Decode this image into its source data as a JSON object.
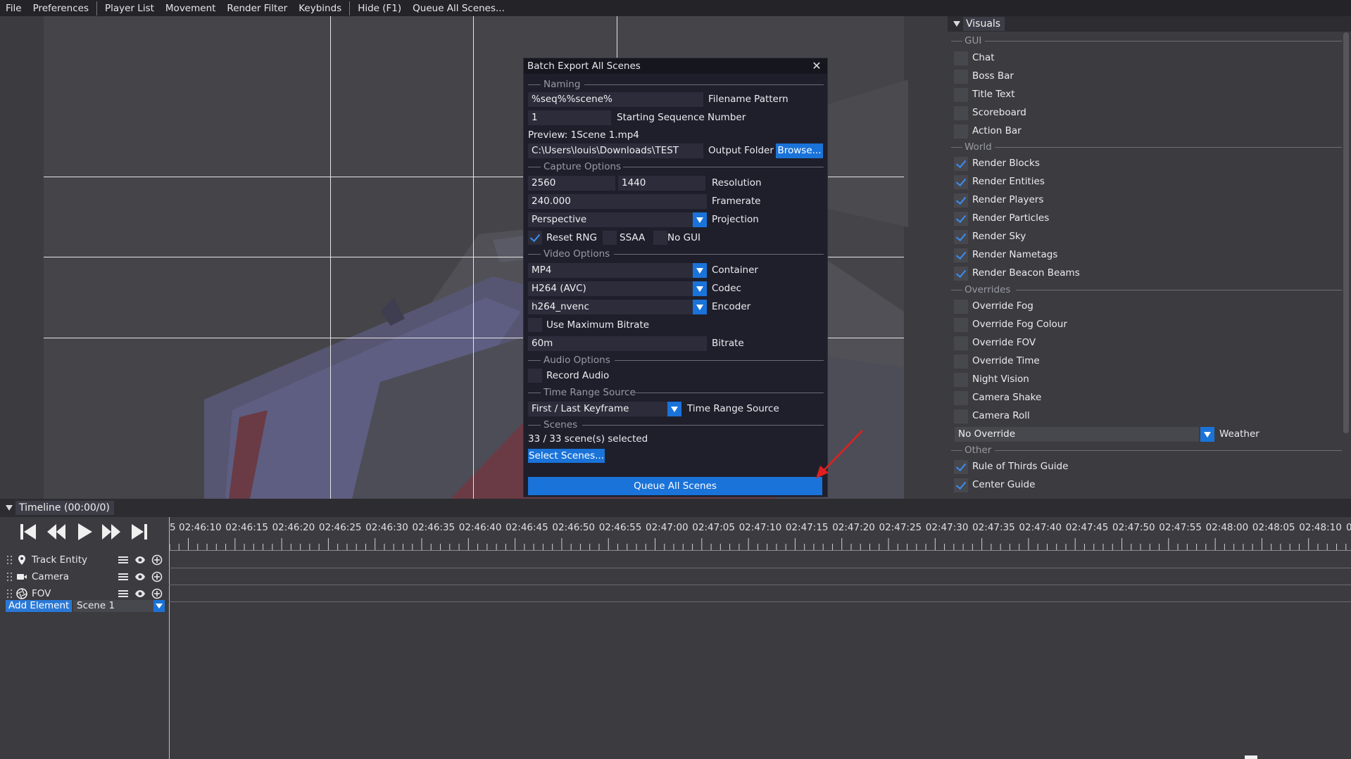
{
  "menu": {
    "items": [
      "File",
      "Preferences",
      "Player List",
      "Movement",
      "Render Filter",
      "Keybinds",
      "Hide (F1)",
      "Queue All Scenes..."
    ]
  },
  "dialog": {
    "title": "Batch Export All Scenes",
    "naming": {
      "section": "Naming",
      "filename_pattern_value": "%seq%%scene%",
      "filename_pattern_label": "Filename Pattern",
      "start_seq_value": "1",
      "start_seq_label": "Starting Sequence Number",
      "preview": "Preview: 1Scene 1.mp4",
      "output_folder_value": "C:\\Users\\louis\\Downloads\\TEST",
      "output_folder_label": "Output Folder",
      "browse_label": "Browse..."
    },
    "capture": {
      "section": "Capture Options",
      "width": "2560",
      "height": "1440",
      "resolution_label": "Resolution",
      "framerate_value": "240.000",
      "framerate_label": "Framerate",
      "projection_value": "Perspective",
      "projection_label": "Projection",
      "reset_rng_label": "Reset RNG",
      "reset_rng_checked": true,
      "ssaa_label": "SSAA",
      "ssaa_checked": false,
      "no_gui_label": "No GUI",
      "no_gui_checked": false
    },
    "video": {
      "section": "Video Options",
      "container_value": "MP4",
      "container_label": "Container",
      "codec_value": "H264 (AVC)",
      "codec_label": "Codec",
      "encoder_value": "h264_nvenc",
      "encoder_label": "Encoder",
      "max_bitrate_label": "Use Maximum Bitrate",
      "bitrate_value": "60m",
      "bitrate_label": "Bitrate"
    },
    "audio": {
      "section": "Audio Options",
      "record_audio_label": "Record Audio"
    },
    "time_range": {
      "section": "Time Range Source",
      "value": "First / Last Keyframe",
      "label": "Time Range Source"
    },
    "scenes": {
      "section": "Scenes",
      "selected_text": "33 / 33 scene(s) selected",
      "select_button": "Select Scenes..."
    },
    "queue_button": "Queue All Scenes"
  },
  "visuals": {
    "title": "Visuals",
    "gui_section": "GUI",
    "gui": [
      {
        "label": "Chat",
        "checked": false
      },
      {
        "label": "Boss Bar",
        "checked": false
      },
      {
        "label": "Title Text",
        "checked": false
      },
      {
        "label": "Scoreboard",
        "checked": false
      },
      {
        "label": "Action Bar",
        "checked": false
      }
    ],
    "world_section": "World",
    "world": [
      {
        "label": "Render Blocks",
        "checked": true
      },
      {
        "label": "Render Entities",
        "checked": true
      },
      {
        "label": "Render Players",
        "checked": true
      },
      {
        "label": "Render Particles",
        "checked": true
      },
      {
        "label": "Render Sky",
        "checked": true
      },
      {
        "label": "Render Nametags",
        "checked": true
      },
      {
        "label": "Render Beacon Beams",
        "checked": true
      }
    ],
    "overrides_section": "Overrides",
    "overrides": [
      {
        "label": "Override Fog",
        "checked": false
      },
      {
        "label": "Override Fog Colour",
        "checked": false
      },
      {
        "label": "Override FOV",
        "checked": false
      },
      {
        "label": "Override Time",
        "checked": false
      },
      {
        "label": "Night Vision",
        "checked": false
      },
      {
        "label": "Camera Shake",
        "checked": false
      },
      {
        "label": "Camera Roll",
        "checked": false
      }
    ],
    "weather_value": "No Override",
    "weather_label": "Weather",
    "other_section": "Other",
    "other": [
      {
        "label": "Rule of Thirds Guide",
        "checked": true
      },
      {
        "label": "Center Guide",
        "checked": true
      }
    ]
  },
  "timeline": {
    "title": "Timeline (00:00/0)",
    "leading_tick_fragment": "5",
    "ticks": [
      "02:46:10",
      "02:46:15",
      "02:46:20",
      "02:46:25",
      "02:46:30",
      "02:46:35",
      "02:46:40",
      "02:46:45",
      "02:46:50",
      "02:46:55",
      "02:47:00",
      "02:47:05",
      "02:47:10",
      "02:47:15",
      "02:47:20",
      "02:47:25",
      "02:47:30",
      "02:47:35",
      "02:47:40",
      "02:47:45",
      "02:47:50",
      "02:47:55",
      "02:48:00",
      "02:48:05",
      "02:48:10"
    ],
    "trailing_tick_fragment": "0",
    "tracks": [
      {
        "name": "Track Entity",
        "icon": "map-pin-icon"
      },
      {
        "name": "Camera",
        "icon": "video-camera-icon"
      },
      {
        "name": "FOV",
        "icon": "aperture-icon"
      }
    ],
    "add_element_label": "Add Element",
    "scene_value": "Scene 1"
  },
  "colors": {
    "accent": "#1a73d9",
    "dialog_bg": "#1f1f2c",
    "panel_bg": "#3b3b40",
    "arrow": "#e02020"
  }
}
